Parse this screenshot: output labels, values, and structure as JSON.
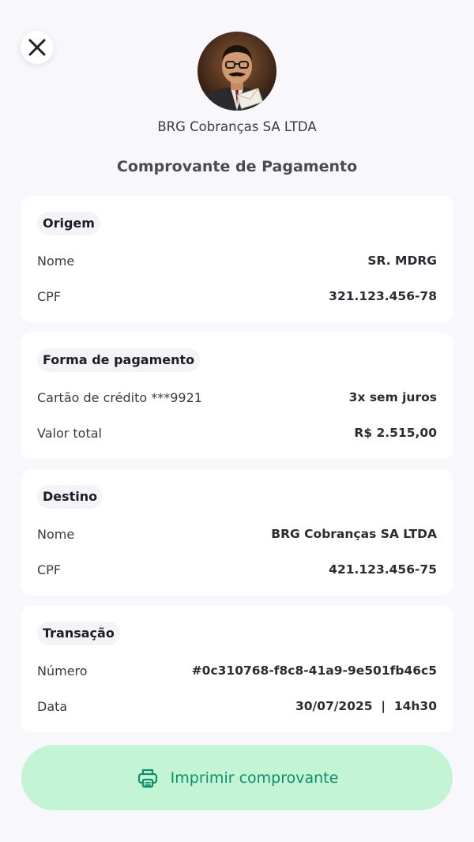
{
  "header": {
    "company_name": "BRG Cobranças SA LTDA",
    "title": "Comprovante de Pagamento"
  },
  "sections": [
    {
      "tag": "Origem",
      "rows": [
        {
          "label": "Nome",
          "value": "SR. MDRG"
        },
        {
          "label": "CPF",
          "value": "321.123.456-78"
        }
      ]
    },
    {
      "tag": "Forma de pagamento",
      "rows": [
        {
          "label": "Cartão de crédito ***9921",
          "value": "3x sem juros"
        },
        {
          "label": "Valor total",
          "value": "R$ 2.515,00"
        }
      ]
    },
    {
      "tag": "Destino",
      "rows": [
        {
          "label": "Nome",
          "value": "BRG Cobranças SA LTDA"
        },
        {
          "label": "CPF",
          "value": "421.123.456-75"
        }
      ]
    },
    {
      "tag": "Transação",
      "rows": [
        {
          "label": "Número",
          "value": "#0c310768-f8c8-41a9-9e501fb46c5"
        },
        {
          "label": "Data",
          "value": "30/07/2025  |  14h30"
        }
      ]
    }
  ],
  "actions": {
    "print_label": "Imprimir comprovante"
  },
  "icons": {
    "close": "close-icon",
    "print": "printer-icon",
    "avatar": "company-avatar"
  },
  "colors": {
    "background": "#f7f7fc",
    "card": "#ffffff",
    "tag_bg": "#f3f3f8",
    "button_bg": "#c3f5d5",
    "button_text": "#0c8f6d"
  }
}
